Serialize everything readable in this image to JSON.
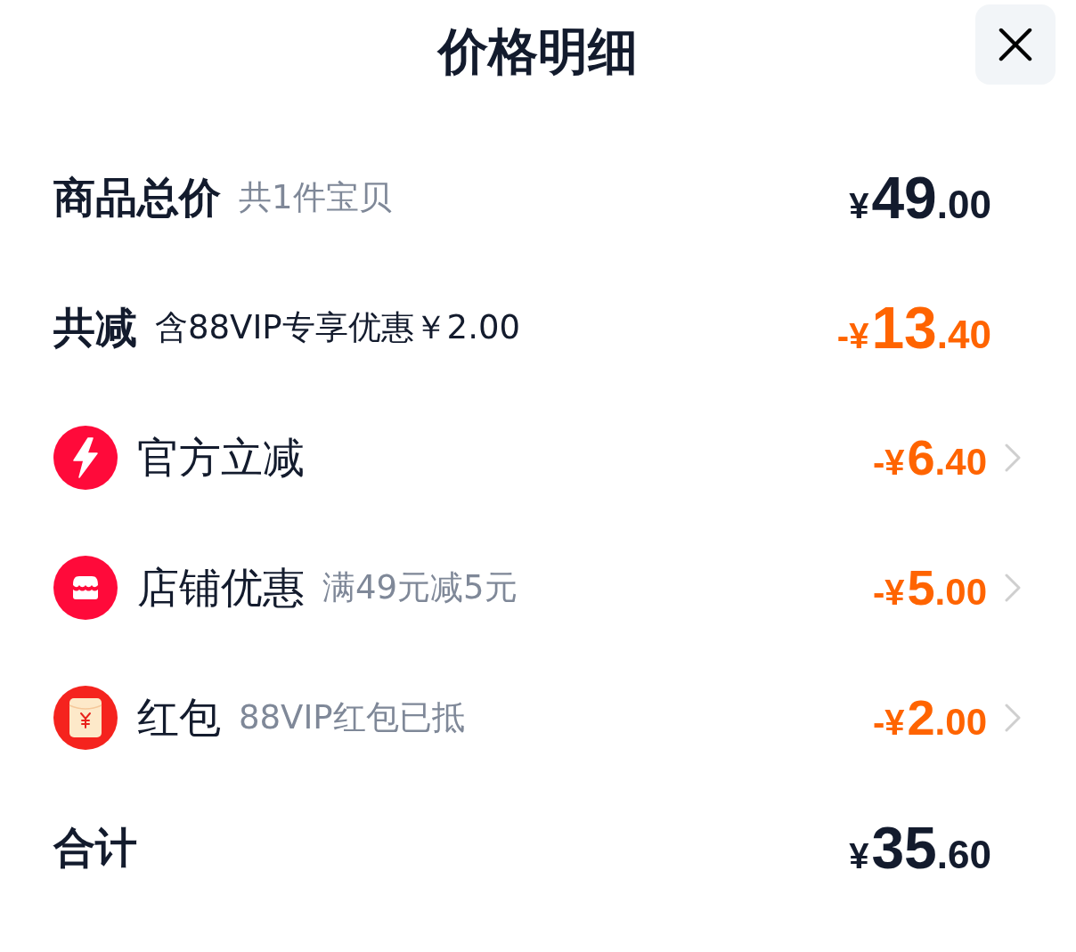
{
  "header": {
    "title": "价格明细"
  },
  "rows": [
    {
      "kind": "summary",
      "label": "商品总价",
      "note": "共1件宝贝",
      "note_muted": true,
      "deduction": false,
      "price": {
        "currency": "¥",
        "integer": "49",
        "decimal": ".00"
      }
    },
    {
      "kind": "summary",
      "label": "共减",
      "note": "含88VIP专享优惠￥2.00",
      "note_muted": false,
      "deduction": true,
      "price": {
        "currency": "-¥",
        "integer": "13",
        "decimal": ".40"
      }
    },
    {
      "kind": "detail",
      "label": "官方立减",
      "deduction": true,
      "price": {
        "currency": "-¥",
        "integer": "6",
        "decimal": ".40"
      }
    },
    {
      "kind": "detail",
      "label": "店铺优惠",
      "note": "满49元减5元",
      "note_muted": true,
      "deduction": true,
      "price": {
        "currency": "-¥",
        "integer": "5",
        "decimal": ".00"
      }
    },
    {
      "kind": "detail",
      "label": "红包",
      "note": "88VIP红包已抵",
      "note_muted": true,
      "deduction": true,
      "price": {
        "currency": "-¥",
        "integer": "2",
        "decimal": ".00"
      }
    },
    {
      "kind": "summary",
      "label": "合计",
      "deduction": false,
      "price": {
        "currency": "¥",
        "integer": "35",
        "decimal": ".60"
      }
    }
  ]
}
